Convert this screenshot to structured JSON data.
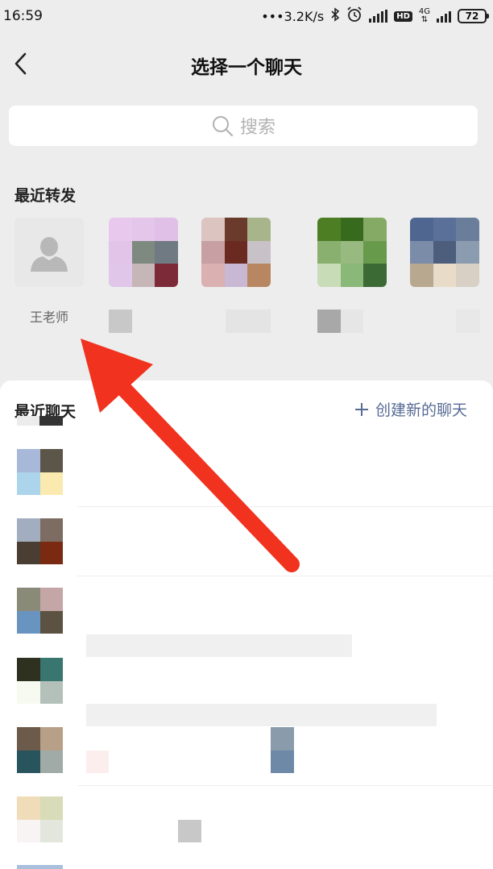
{
  "status_bar": {
    "time": "16:59",
    "network_speed": "•••3.2K/s",
    "hd": "HD",
    "net_type": "4G",
    "battery": "72"
  },
  "header": {
    "title": "选择一个聊天"
  },
  "search": {
    "placeholder": "搜索"
  },
  "recent_forwards": {
    "title": "最近转发",
    "items": [
      {
        "name": "王老师",
        "avatar": "default-person"
      },
      {
        "name": "",
        "avatar": "mosaic"
      },
      {
        "name": "",
        "avatar": "mosaic"
      },
      {
        "name": "",
        "avatar": "mosaic"
      },
      {
        "name": "",
        "avatar": "mosaic"
      }
    ]
  },
  "recent_chats": {
    "title": "最近聊天",
    "new_chat_label": "创建新的聊天"
  },
  "colors": {
    "background": "#ededed",
    "link_blue": "#576b95",
    "arrow_red": "#f0321e"
  }
}
